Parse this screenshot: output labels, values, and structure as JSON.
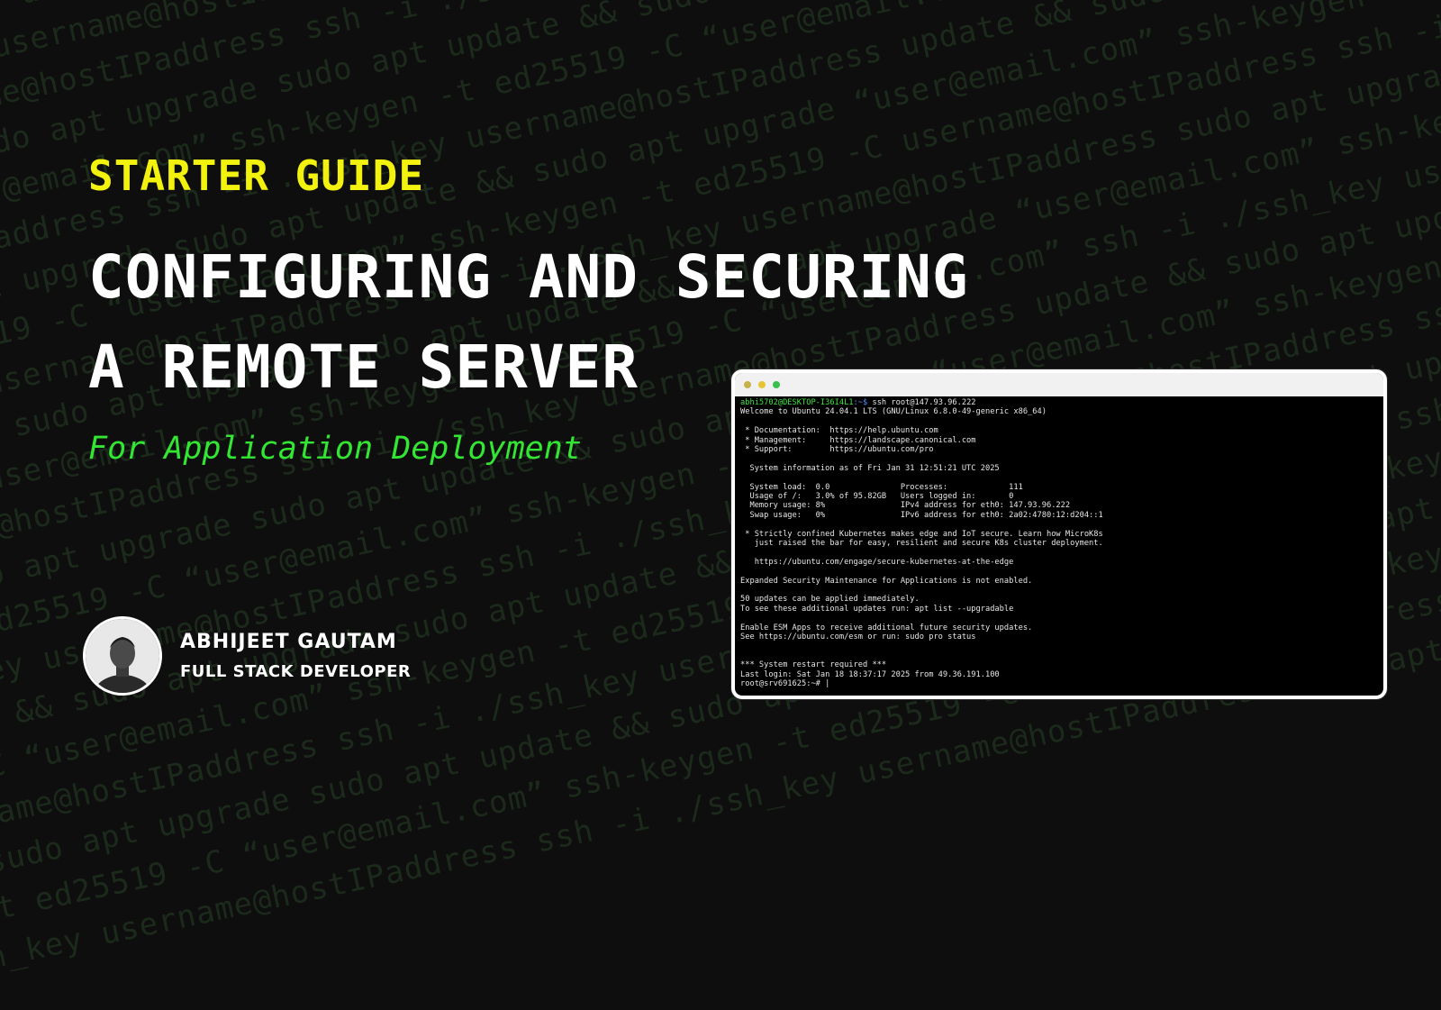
{
  "background": {
    "lines": [
      "ssh-keygen -t ed25519 -C “user@email.com” ssh-keygen -t ed25519 -C “user@email.com” ssh-keygen",
      "gen -t ed25519 -C “user@email.com” ssh-keygen -i ./ssh_key username@hostIPaddress sudo apt update",
      "ssh -i ./ssh_key username@hostIPaddress ssh -i ./ssh_key username@hostIPaddress update && sudo apt upgrade",
      "./ssh_key username@hostIPaddress ssh -i ./ssh_key username@hostIPaddress update && sudo apt upgrade",
      "apt update && sudo apt upgrade sudo apt update && sudo apt upgrade “user@email.com” ssh-keygen -t ed25519 -C",
      "ed25519 -C “user@email.com” ssh-keygen -t ed25519 -C “user@email.com” ssh -i ./ssh_key username",
      "username@hostIPaddress ssh -i ./ssh_key username@hostIPaddress update && sudo apt update && sudo apt upgrade",
      "ate && sudo apt upgrade sudo apt update && sudo apt upgrade “user@email.com” ssh-keygen -t ed25519 -C",
      "eygen -t ed25519 -C “user@email.com” ssh-keygen -t ed25519 -C username@hostIPaddress ssh -i ./ssh_key",
      "-i ./ssh_key username@hostIPaddress ssh -i ./ssh_key username@hostIPaddress sudo apt upgrade sudo apt upd",
      "apt update && sudo apt upgrade sudo apt update && sudo apt upgrade “user@email.com” ssh-keygen -t ed25519",
      "ed25519 -C “user@email.com” ssh-keygen -t ed25519 -C “user@email.com” ssh -i ./ssh_key username",
      "key username@hostIPaddress ssh -i ./ssh_key username@hostIPaddress update && sudo apt update && sudo apt",
      "date && sudo apt upgrade sudo apt update && sudo apt upgrade “user@email.com” ssh-keygen -t ed25519 -C",
      "keygen -t ed25519 -C “user@email.com” ssh-keygen -t ed25519 -C username@hostIPaddress ssh -i ./ssh_key",
      "-i ./ssh_key username@hostIPaddress ssh -i ./ssh_key username@hostIPaddress sudo apt upgrade sudo apt upd",
      "apt update && sudo apt upgrade sudo apt update && sudo apt upgrade “user@email.com” ssh-keygen -t ed25519",
      "ed25519 -C “user@email.com” ssh-keygen -t ed25519 -C “user@email.com” ssh -i ./ssh_key username",
      "key username@hostIPaddress ssh -i ./ssh_key username@hostIPaddress update && sudo apt update && sudo apt",
      "date && sudo apt upgrade sudo apt update && sudo apt upgrade “user@email.com” ssh-keygen -t ed25519 -C",
      "keygen -t ed25519 -C “user@email.com” ssh-keygen -t ed25519 -C username@hostIPaddress ssh -i ./ssh_key",
      "-i ./ssh_key username@hostIPaddress ssh -i ./ssh_key username@hostIPaddress sudo apt upgrade sudo apt upd"
    ]
  },
  "eyebrow": "STARTER GUIDE",
  "title": {
    "line1": "CONFIGURING AND SECURING",
    "line2": "A REMOTE SERVER"
  },
  "subtitle": "For Application Deployment",
  "author": {
    "name": "ABHIJEET GAUTAM",
    "role": "FULL STACK DEVELOPER"
  },
  "terminal": {
    "dots": [
      "#c6b24a",
      "#e5c534",
      "#39c04a"
    ],
    "prompt_user": "abhi5702@DESKTOP-I36I4L1",
    "prompt_path": ":~$",
    "command": " ssh root@147.93.96.222",
    "lines": [
      "Welcome to Ubuntu 24.04.1 LTS (GNU/Linux 6.8.0-49-generic x86_64)",
      "",
      " * Documentation:  https://help.ubuntu.com",
      " * Management:     https://landscape.canonical.com",
      " * Support:        https://ubuntu.com/pro",
      "",
      "  System information as of Fri Jan 31 12:51:21 UTC 2025",
      "",
      "  System load:  0.0               Processes:             111",
      "  Usage of /:   3.0% of 95.82GB   Users logged in:       0",
      "  Memory usage: 8%                IPv4 address for eth0: 147.93.96.222",
      "  Swap usage:   0%                IPv6 address for eth0: 2a02:4780:12:d204::1",
      "",
      " * Strictly confined Kubernetes makes edge and IoT secure. Learn how MicroK8s",
      "   just raised the bar for easy, resilient and secure K8s cluster deployment.",
      "",
      "   https://ubuntu.com/engage/secure-kubernetes-at-the-edge",
      "",
      "Expanded Security Maintenance for Applications is not enabled.",
      "",
      "50 updates can be applied immediately.",
      "To see these additional updates run: apt list --upgradable",
      "",
      "Enable ESM Apps to receive additional future security updates.",
      "See https://ubuntu.com/esm or run: sudo pro status",
      "",
      "",
      "*** System restart required ***",
      "Last login: Sat Jan 18 18:37:17 2025 from 49.36.191.100",
      "root@srv691625:~# |"
    ]
  }
}
